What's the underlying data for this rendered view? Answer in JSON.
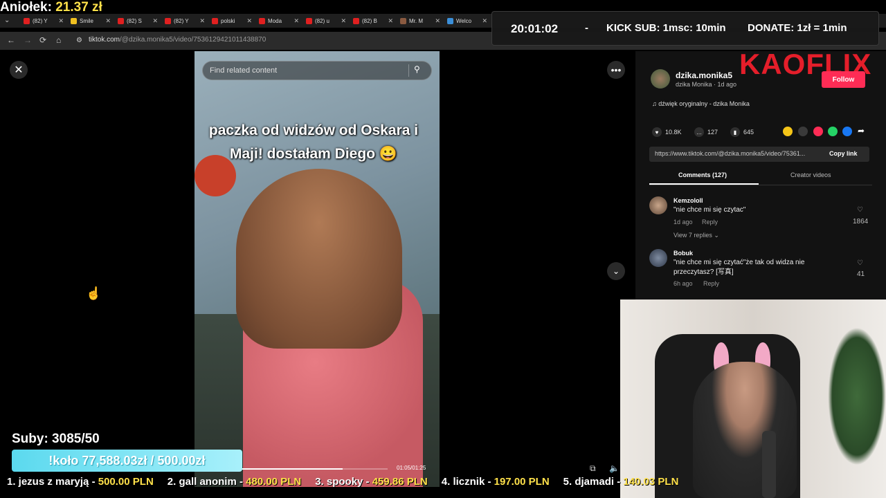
{
  "overlay": {
    "aniolek_label": "Aniołek:",
    "aniolek_amount": "21.37 zł",
    "clock": "20:01:02",
    "separator": "-",
    "kick_sub": "KICK SUB: 1msc: 10min",
    "donate": "DONATE: 1zł = 1min",
    "brand": "KAOFLIX",
    "suby": "Suby: 3085/50",
    "kolo": "!koło 77,588.03zł / 500.00zł",
    "ticker": [
      {
        "name": "1. jezus z maryją - ",
        "amount": "500.00 PLN"
      },
      {
        "name": "2. gall anonim - ",
        "amount": "480.00 PLN"
      },
      {
        "name": "3. spooky - ",
        "amount": "459.86 PLN"
      },
      {
        "name": "4. licznik - ",
        "amount": "197.00 PLN"
      },
      {
        "name": "5. djamadi - ",
        "amount": "140.03 PLN"
      }
    ]
  },
  "browser": {
    "tabs": [
      "(82) Y",
      "Smile",
      "(82) S",
      "(82) Y",
      "polski",
      "Moda",
      "(82) u",
      "(82) B",
      "Mr. M",
      "Welco"
    ],
    "url_host": "tiktok.com",
    "url_path": "/@dzika.monika5/video/7536129421011438870"
  },
  "video": {
    "search_placeholder": "Find related content",
    "caption": "paczka od widzów od Oskara i Maji! dostałam Diego 😀",
    "time": "01:05/01:25",
    "progress": 0.76
  },
  "author": {
    "username": "dzika.monika5",
    "display": "dzika Monika · 1d ago",
    "follow_label": "Follow",
    "music": "dźwięk oryginalny - dzika Monika"
  },
  "stats": {
    "likes": "10.8K",
    "comments": "127",
    "saves": "645"
  },
  "share": {
    "link": "https://www.tiktok.com/@dzika.monika5/video/75361...",
    "copy_label": "Copy link",
    "colors": [
      "#f5c518",
      "#3a3a3a",
      "#fe2c55",
      "#25d366",
      "#1877f2"
    ]
  },
  "panel_tabs": {
    "comments": "Comments (127)",
    "creator": "Creator videos"
  },
  "comments": [
    {
      "name": "Kemzololl",
      "text": "\"nie chce mi się czytac\"",
      "time": "1d ago",
      "reply": "Reply",
      "likes": "1864",
      "replies": "View 7 replies"
    },
    {
      "name": "Bobuk",
      "text": "\"nie chce mi się czytać\"że tak od widza nie przeczytasz? [写真]",
      "time": "6h ago",
      "reply": "Reply",
      "likes": "41"
    }
  ]
}
